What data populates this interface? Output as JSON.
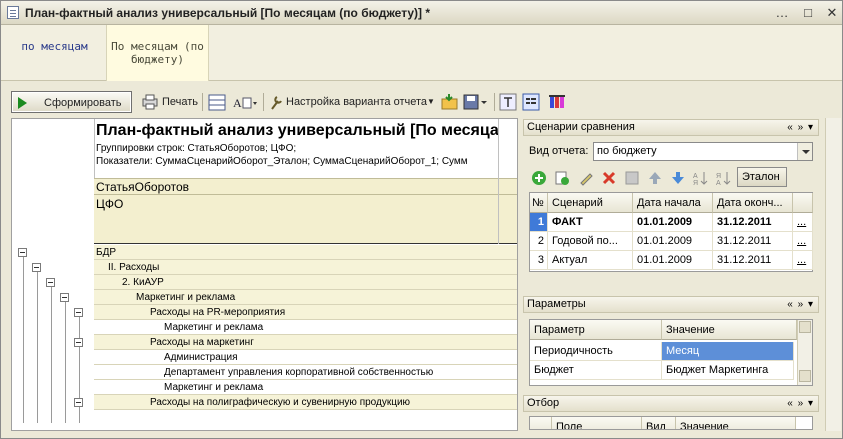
{
  "window": {
    "title": "План-фактный анализ универсальный [По месяцам (по бюджету)] *",
    "buttons": [
      "…",
      "□",
      "✕"
    ]
  },
  "tabs": [
    {
      "label": "по месяцам",
      "active": false
    },
    {
      "label": "По месяцам (по бюджету)",
      "active": true
    }
  ],
  "toolbar": {
    "generate_label": "Сформировать",
    "print_label": "Печать",
    "variant_settings_label": "Настройка варианта отчета"
  },
  "report": {
    "title": "План-фактный анализ универсальный [По месяца",
    "grouping_line": "Группировки строк: СтатьяОборотов; ЦФО;",
    "indicators_line": "Показатели: СуммаСценарийОборот_Эталон; СуммаСценарийОборот_1; Сумм",
    "column_header_1": "СтатьяОборотов",
    "column_header_2": "ЦФО",
    "rows": [
      {
        "text": "БДР"
      },
      {
        "text": "II. Расходы"
      },
      {
        "text": "2. КиАУР"
      },
      {
        "text": "Маркетинг и реклама"
      },
      {
        "text": "Расходы на PR-мероприятия"
      },
      {
        "text": "Маркетинг и реклама"
      },
      {
        "text": "Расходы на маркетинг"
      },
      {
        "text": "Администрация"
      },
      {
        "text": "Департамент управления корпоративной собственностью"
      },
      {
        "text": "Маркетинг и реклама"
      },
      {
        "text": "Расходы на полиграфическую и сувенирную продукцию"
      }
    ]
  },
  "scenarios_panel": {
    "title": "Сценарии сравнения",
    "report_kind_label": "Вид отчета:",
    "report_kind_value": "по бюджету",
    "etalon_button": "Эталон",
    "columns": [
      "№",
      "Сценарий",
      "Дата начала",
      "Дата оконч..."
    ],
    "rows": [
      {
        "n": "1",
        "scenario": "ФАКТ",
        "start": "01.01.2009",
        "end": "31.12.2011",
        "more": "..."
      },
      {
        "n": "2",
        "scenario": "Годовой по...",
        "start": "01.01.2009",
        "end": "31.12.2011",
        "more": "..."
      },
      {
        "n": "3",
        "scenario": "Актуал",
        "start": "01.01.2009",
        "end": "31.12.2011",
        "more": "..."
      }
    ]
  },
  "params_panel": {
    "title": "Параметры",
    "columns": [
      "Параметр",
      "Значение"
    ],
    "rows": [
      {
        "param": "Периодичность",
        "value": "Месяц"
      },
      {
        "param": "Бюджет",
        "value": "Бюджет Маркетинга"
      }
    ]
  },
  "filter_panel": {
    "title": "Отбор",
    "columns": [
      "Поле",
      "Вид",
      "Значение"
    ]
  },
  "panel_controls": "« » ▾",
  "colors": {
    "accent_blue": "#3f7ad8",
    "selected_value": "#5d8fd8",
    "report_yellow": "#f3efcf"
  }
}
